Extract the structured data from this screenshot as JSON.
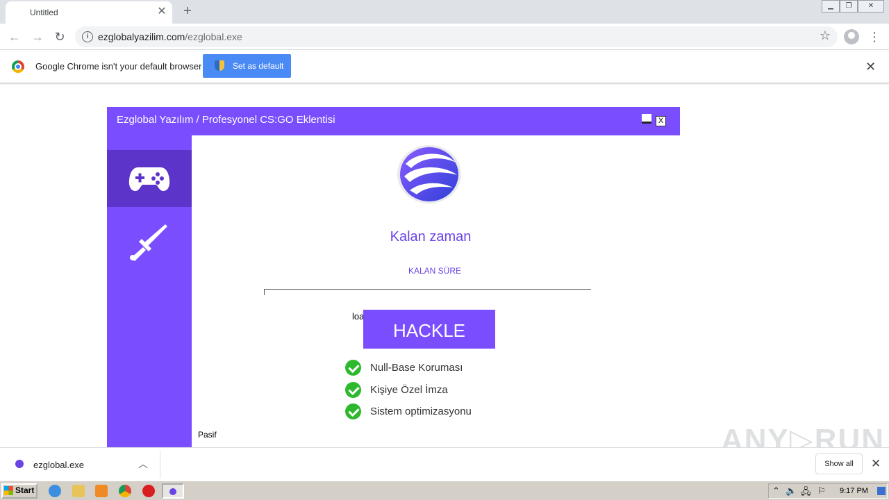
{
  "browser": {
    "tab_title": "Untitled",
    "tab_close": "✕",
    "new_tab": "+",
    "url_host": "ezglobalyazilim.com",
    "url_path": "/ezglobal.exe",
    "infobar_message": "Google Chrome isn't your default browser",
    "set_default_label": "Set as default",
    "close_glyph": "✕"
  },
  "app": {
    "title": "Ezglobal Yazılım / Profesyonel CS:GO Eklentisi",
    "close_label": "X",
    "sidebar_items": [
      {
        "icon": "gamepad-icon",
        "active": true
      },
      {
        "icon": "sword-icon",
        "active": false
      }
    ],
    "remaining_title": "Kalan zaman",
    "remaining_subtitle": "KALAN SÜRE",
    "loading_text": "loa",
    "hack_button": "HACKLE",
    "features": [
      "Null-Base Koruması",
      "Kişiye Özel İmza",
      "Sistem optimizasyonu"
    ],
    "status": "Pasif",
    "accent_color": "#7a4dff",
    "check_color": "#2db82d"
  },
  "downloads": {
    "file_name": "ezglobal.exe",
    "show_all": "Show all"
  },
  "watermark": "ANY▷RUN",
  "taskbar": {
    "start_label": "Start",
    "clock": "9:17 PM"
  }
}
